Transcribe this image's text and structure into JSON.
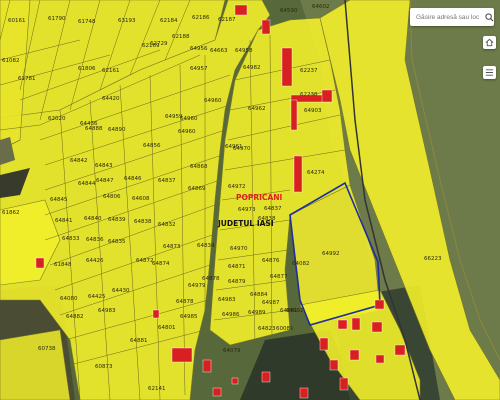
{
  "search": {
    "placeholder": "Găsire adresă sau loc"
  },
  "controls": {
    "home_icon": "home-icon",
    "layers_icon": "layers-icon"
  },
  "places": {
    "locality": "POPRICANI",
    "county": "JUDETUL IASI"
  },
  "colors": {
    "parcel_fill": "#f2ee2a",
    "parcel_stroke": "#6b6a1c",
    "building": "#d92020",
    "selection": "#1c2ea0",
    "locality_label": "#e02020"
  },
  "parcels": [
    "60161",
    "61790",
    "61748",
    "63193",
    "62184",
    "62186",
    "62187",
    "64602",
    "61082",
    "61781",
    "62169",
    "62729",
    "62188",
    "64590",
    "62020",
    "61806",
    "62161",
    "64956",
    "64663",
    "64958",
    "64436",
    "64420",
    "64957",
    "64960",
    "64982",
    "62237",
    "62238",
    "64888",
    "64890",
    "64959",
    "64960",
    "64961",
    "64962",
    "64903",
    "64842",
    "64843",
    "64856",
    "64960",
    "64970",
    "64274",
    "64844",
    "64847",
    "64846",
    "64837",
    "64868",
    "64972",
    "61862",
    "64845",
    "64806",
    "64608",
    "64869",
    "64973",
    "64841",
    "64840",
    "64839",
    "64838",
    "64832",
    "64834",
    "64838",
    "64837",
    "64833",
    "64836",
    "64835",
    "64873",
    "64970",
    "64871",
    "64876",
    "64877",
    "61848",
    "64426",
    "64872",
    "64874",
    "64878",
    "64879",
    "64080",
    "64425",
    "64430",
    "64979",
    "64983",
    "64884",
    "64987",
    "64882",
    "64983",
    "64985",
    "64986",
    "64989",
    "64992",
    "60738",
    "60873",
    "62141",
    "64881",
    "64801",
    "64878",
    "64881",
    "64823",
    "64082",
    "64079",
    "60081",
    "64992",
    "66223"
  ]
}
